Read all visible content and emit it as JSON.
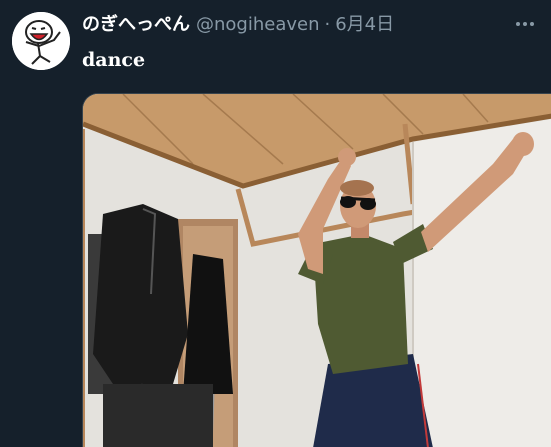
{
  "tweet": {
    "display_name": "のぎへっぺん",
    "handle": "@nogiheaven",
    "separator": "·",
    "date": "6月4日",
    "text": "dance",
    "more_icon": "more-horizontal-icon",
    "avatar_icon": "cartoon-character-avatar",
    "media_description_icon": "photo-icon"
  },
  "colors": {
    "background": "#15202b",
    "primary_text": "#ffffff",
    "secondary_text": "#8899a6",
    "border": "#38444d"
  }
}
